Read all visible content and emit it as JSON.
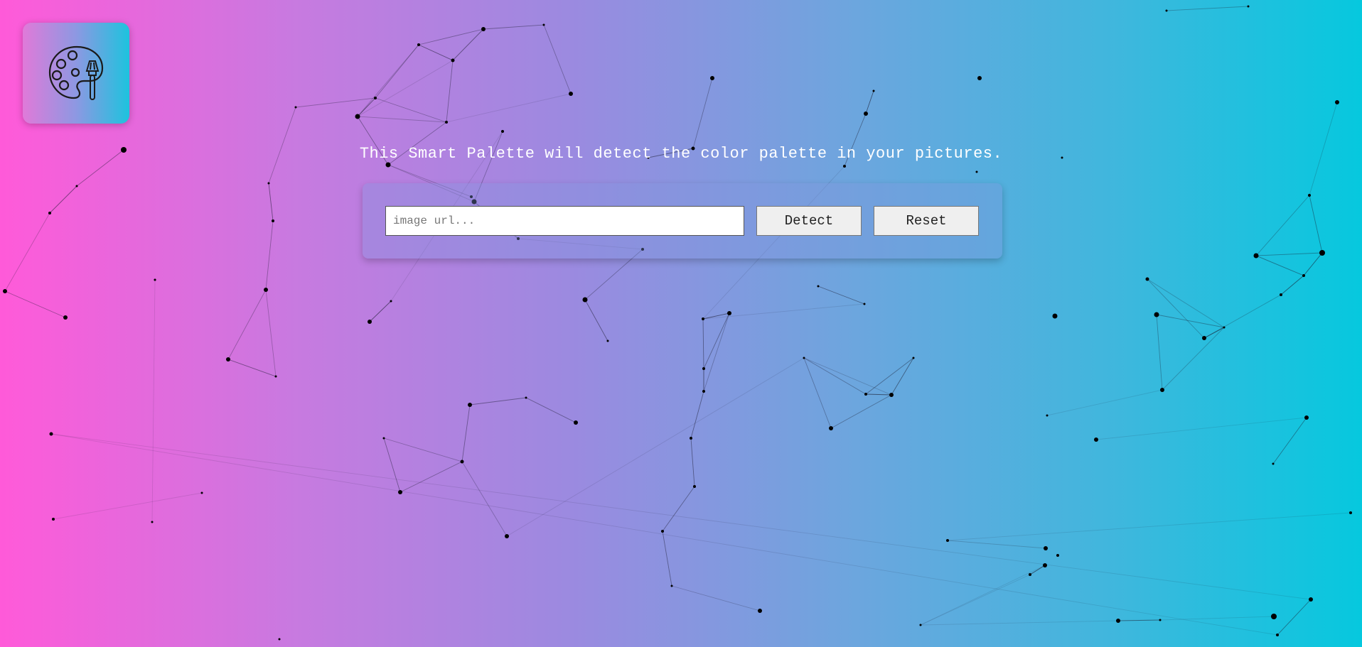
{
  "logo": {
    "icon": "palette-brush-icon"
  },
  "tagline": "This Smart Palette will detect the color palette in your pictures.",
  "search": {
    "placeholder": "image url...",
    "value": ""
  },
  "buttons": {
    "detect_label": "Detect",
    "reset_label": "Reset"
  },
  "colors": {
    "gradient_start": "#ff5ad9",
    "gradient_end": "#06c8de",
    "node_color": "#000000"
  }
}
